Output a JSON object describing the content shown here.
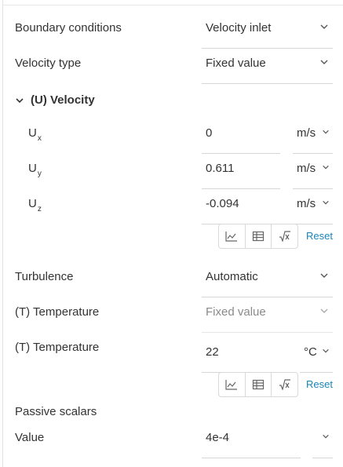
{
  "boundary": {
    "label": "Boundary conditions",
    "value": "Velocity inlet"
  },
  "velocity_type": {
    "label": "Velocity type",
    "value": "Fixed value"
  },
  "velocity_section": {
    "title": "(U) Velocity"
  },
  "velocity": {
    "ux": {
      "label": "U",
      "sub": "x",
      "value": "0",
      "unit": "m/s"
    },
    "uy": {
      "label": "U",
      "sub": "y",
      "value": "0.611",
      "unit": "m/s"
    },
    "uz": {
      "label": "U",
      "sub": "z",
      "value": "-0.094",
      "unit": "m/s"
    }
  },
  "reset_label": "Reset",
  "turbulence": {
    "label": "Turbulence",
    "value": "Automatic"
  },
  "temperature_type": {
    "label": "(T) Temperature",
    "value": "Fixed value"
  },
  "temperature": {
    "label": "(T) Temperature",
    "value": "22",
    "unit": "°C"
  },
  "passive_scalars": {
    "label": "Passive scalars"
  },
  "scalar_value": {
    "label": "Value",
    "value": "4e-4"
  },
  "colors": {
    "accent": "#1a84b8",
    "text": "#333333",
    "muted": "#8a8a8a",
    "border": "#d6d6d6"
  }
}
